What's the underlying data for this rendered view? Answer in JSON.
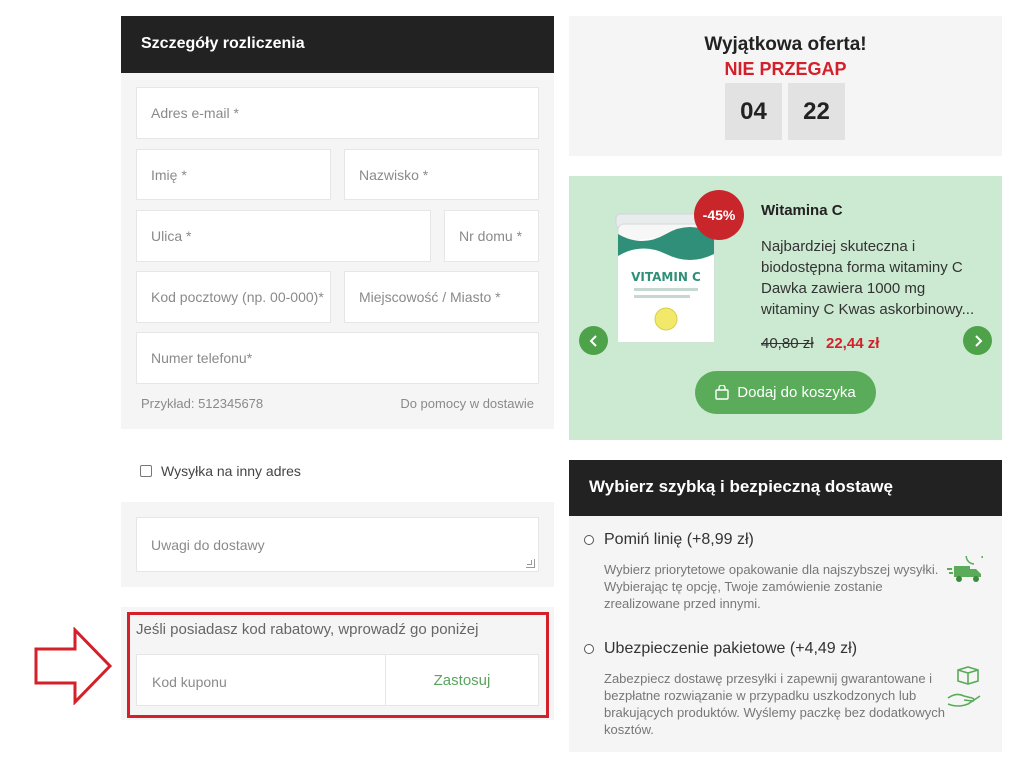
{
  "billing": {
    "title": "Szczegóły rozliczenia",
    "email_placeholder": "Adres e-mail *",
    "first_name_placeholder": "Imię *",
    "last_name_placeholder": "Nazwisko *",
    "street_placeholder": "Ulica *",
    "house_number_placeholder": "Nr domu *",
    "postcode_placeholder": "Kod pocztowy (np. 00-000)*",
    "city_placeholder": "Miejscowość / Miasto *",
    "phone_placeholder": "Numer telefonu*",
    "phone_example": "Przykład: 512345678",
    "phone_help": "Do pomocy w dostawie"
  },
  "shipping": {
    "other_address_label": "Wysyłka na inny adres",
    "notes_placeholder": "Uwagi do dostawy"
  },
  "coupon": {
    "prompt": "Jeśli posiadasz kod rabatowy, wprowadź go poniżej",
    "placeholder": "Kod kuponu",
    "apply_label": "Zastosuj"
  },
  "offer": {
    "title": "Wyjątkowa oferta!",
    "subtitle": "NIE PRZEGAP",
    "timer": [
      "04",
      "22"
    ]
  },
  "promo": {
    "discount_badge": "-45%",
    "product_name": "Witamina C",
    "description": "Najbardziej skuteczna i biodostępna forma witaminy C Dawka zawiera 1000 mg witaminy C Kwas askorbinowy...",
    "old_price": "40,80 zł",
    "new_price": "22,44 zł",
    "add_to_cart_label": "Dodaj do koszyka",
    "product_label": "VITAMIN C"
  },
  "delivery": {
    "title": "Wybierz szybką i bezpieczną dostawę",
    "options": [
      {
        "label": "Pomiń linię (+8,99 zł)",
        "description": "Wybierz priorytetowe opakowanie dla najszybszej wysyłki. Wybierając tę opcję, Twoje zamówienie zostanie zrealizowane przed innymi."
      },
      {
        "label": "Ubezpieczenie pakietowe (+4,49 zł)",
        "description": "Zabezpiecz dostawę przesyłki i zapewnij gwarantowane i bezpłatne rozwiązanie w przypadku uszkodzonych lub brakujących produktów. Wyślemy paczkę bez dodatkowych kosztów."
      }
    ]
  },
  "colors": {
    "accent_red": "#d4202a",
    "accent_green": "#5aab5a",
    "promo_background": "#cce9d1",
    "header_dark": "#222222"
  }
}
